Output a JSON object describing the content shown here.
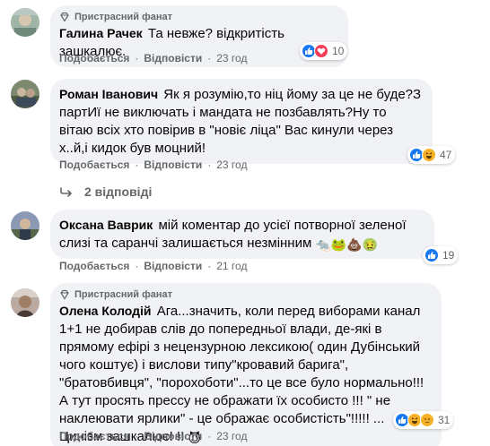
{
  "comments": [
    {
      "badge": "Пристрасний фанат",
      "name": "Галина Рачек",
      "text": "Та невже? відкритість зашкалює.",
      "like_label": "Подобається",
      "reply_label": "Відповісти",
      "time": "23 год",
      "reactions": [
        "like",
        "love"
      ],
      "reaction_count": "10"
    },
    {
      "name": "Роман Іванович",
      "text": "Як я розумію,то ніц йому за це не буде?З партИї не виключать і мандата не позбавлять?Ну то вітаю всіх хто повірив в \"новіє ліца\" Вас кинули через х..й,і кидок був моцний!",
      "like_label": "Подобається",
      "reply_label": "Відповісти",
      "time": "23 год",
      "reactions": [
        "like",
        "haha"
      ],
      "reaction_count": "47",
      "replies_label": "2 відповіді"
    },
    {
      "name": "Оксана Ваврик",
      "text": "мій коментар до усієї потворної зеленої слизі та саранчі залишається незмінним",
      "emojis": "🐀🐸💩🤢",
      "like_label": "Подобається",
      "reply_label": "Відповісти",
      "time": "21 год",
      "reactions": [
        "like"
      ],
      "reaction_count": "19"
    },
    {
      "badge": "Пристрасний фанат",
      "name": "Олена Колодій",
      "text": "Ага...значить, коли перед виборами канал 1+1 не добирав слів до попередньої влади, де-які в прямому ефірі з нецензурною лексикою( один Дубінський чого коштує) і вислови типу\"кровавий барига\", \"братовбивця\", \"порохоботи\"...то це все було нормально!!! А тут просять прессу не ображати їх особисто !!! \" не наклеювати ярлики\" - це ображає особистість\"!!!!! ... Цинізм зашкалює! !!",
      "emojis": "😈",
      "like_label": "Подобається",
      "reply_label": "Відповісти",
      "time": "23 год",
      "reactions": [
        "like",
        "haha",
        "sad"
      ],
      "reaction_count": "31"
    }
  ],
  "colors": {
    "bubble": "#f0f2f5",
    "like": "#1877f2",
    "love": "#f33e58",
    "haha": "#f7b125"
  }
}
